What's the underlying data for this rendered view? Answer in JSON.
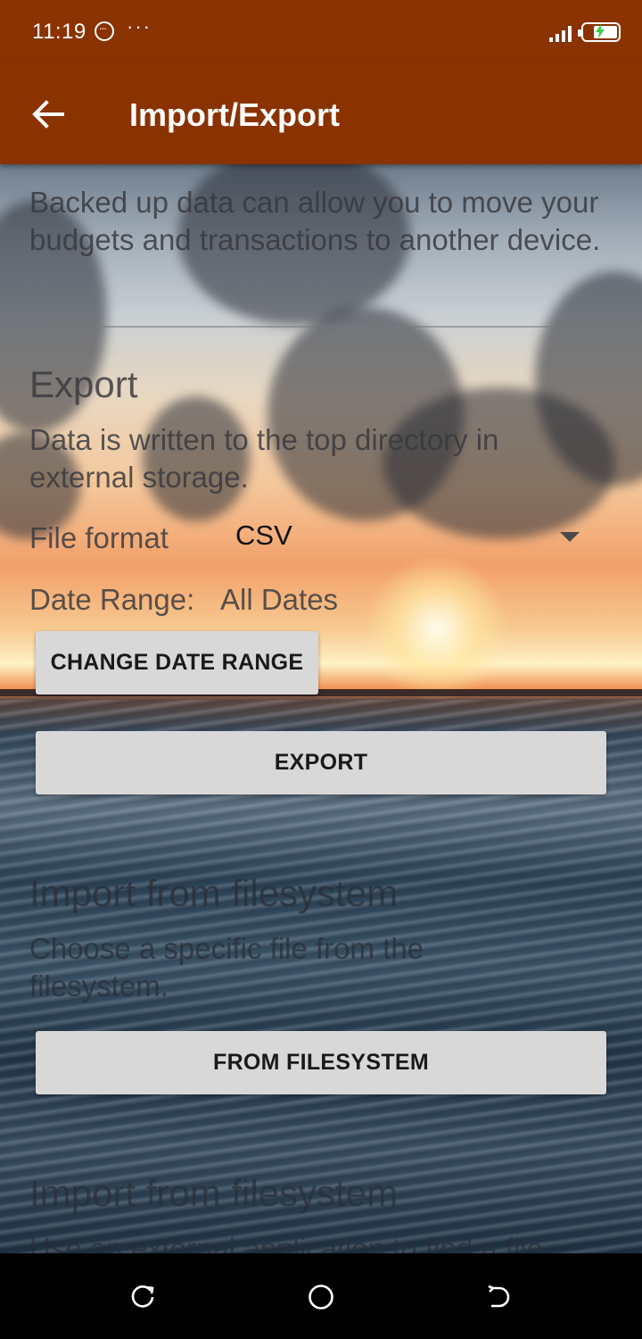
{
  "status_bar": {
    "time": "11:19",
    "icons": [
      "message-icon",
      "more-dots-icon",
      "signal-icon",
      "battery-charging-icon"
    ],
    "more_dots": "···",
    "background_color": "#8a3200"
  },
  "app_bar": {
    "title": "Import/Export",
    "back_icon": "arrow-back-icon",
    "background_color": "#8a3200"
  },
  "intro_text": "Backed up data can allow you to move your budgets and transactions to another device.",
  "export_section": {
    "heading": "Export",
    "description": "Data is written to the top directory in external storage.",
    "file_format_label": "File format",
    "file_format_value": "CSV",
    "date_range_label": "Date Range:",
    "date_range_value": "All Dates",
    "change_date_range_button": "CHANGE DATE RANGE",
    "export_button": "EXPORT"
  },
  "import_filesystem_section": {
    "heading": "Import from filesystem",
    "description": "Choose a specific file from the filesystem.",
    "button": "FROM FILESYSTEM"
  },
  "import_external_section": {
    "heading": "Import from filesystem",
    "description": "Use an external application to find a file."
  },
  "nav_bar": {
    "icons": [
      "recents-icon",
      "home-icon",
      "back-icon"
    ]
  },
  "colors": {
    "accent": "#8a3200",
    "button_background": "#d8d8d8"
  }
}
